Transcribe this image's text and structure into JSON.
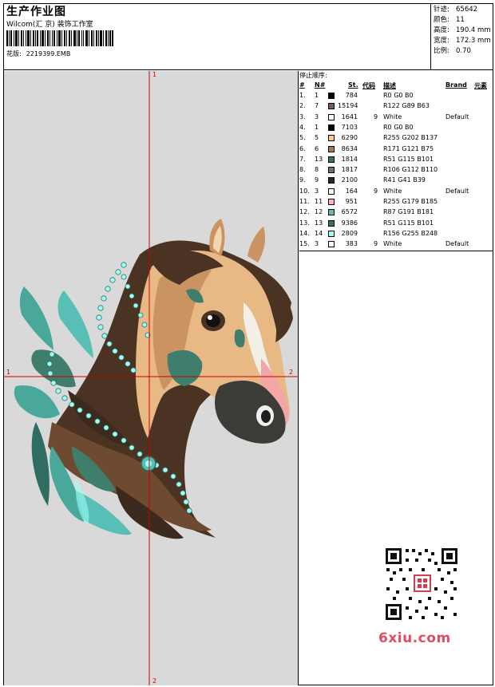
{
  "header": {
    "title": "生产作业图",
    "company": "Wilcom(汇 京) 装饰工作室",
    "pattern_label": "花版:",
    "pattern_file": "2219399.EMB"
  },
  "stats": {
    "stitches_label": "针迹:",
    "stitches": "65642",
    "colors_label": "颜色:",
    "colors": "11",
    "height_label": "高度:",
    "height": "190.4 mm",
    "width_label": "宽度:",
    "width": "172.3 mm",
    "scale_label": "比例:",
    "scale": "0.70"
  },
  "color_table": {
    "title": "停止顺序:",
    "columns": {
      "num": "#",
      "needle": "N#",
      "stitches": "St.",
      "code": "代码",
      "desc": "描述",
      "brand": "Brand",
      "element": "元素"
    },
    "rows": [
      {
        "num": "1.",
        "needle": "1",
        "color": "#000000",
        "stitches": "784",
        "code": "",
        "desc": "R0 G0 B0",
        "brand": ""
      },
      {
        "num": "2.",
        "needle": "7",
        "color": "#7a5963",
        "stitches": "15194",
        "code": "",
        "desc": "R122 G89 B63",
        "brand": ""
      },
      {
        "num": "3.",
        "needle": "3",
        "color": "#ffffff",
        "stitches": "1641",
        "code": "9",
        "desc": "White",
        "brand": "Default"
      },
      {
        "num": "4.",
        "needle": "1",
        "color": "#000000",
        "stitches": "7103",
        "code": "",
        "desc": "R0 G0 B0",
        "brand": ""
      },
      {
        "num": "5.",
        "needle": "5",
        "color": "#ffca89",
        "stitches": "6290",
        "code": "",
        "desc": "R255 G202 B137",
        "brand": ""
      },
      {
        "num": "6.",
        "needle": "6",
        "color": "#ab794b",
        "stitches": "8634",
        "code": "",
        "desc": "R171 G121 B75",
        "brand": ""
      },
      {
        "num": "7.",
        "needle": "13",
        "color": "#337365",
        "stitches": "1814",
        "code": "",
        "desc": "R51 G115 B101",
        "brand": ""
      },
      {
        "num": "8.",
        "needle": "8",
        "color": "#6a706e",
        "stitches": "1817",
        "code": "",
        "desc": "R106 G112 B110",
        "brand": ""
      },
      {
        "num": "9.",
        "needle": "9",
        "color": "#29291b",
        "stitches": "2100",
        "code": "",
        "desc": "R41 G41 B39",
        "brand": ""
      },
      {
        "num": "10.",
        "needle": "3",
        "color": "#ffffff",
        "stitches": "164",
        "code": "9",
        "desc": "White",
        "brand": "Default"
      },
      {
        "num": "11.",
        "needle": "11",
        "color": "#ffb3b9",
        "stitches": "951",
        "code": "",
        "desc": "R255 G179 B185",
        "brand": ""
      },
      {
        "num": "12.",
        "needle": "12",
        "color": "#57bfb5",
        "stitches": "6572",
        "code": "",
        "desc": "R87 G191 B181",
        "brand": ""
      },
      {
        "num": "13.",
        "needle": "13",
        "color": "#337365",
        "stitches": "9386",
        "code": "",
        "desc": "R51 G115 B101",
        "brand": ""
      },
      {
        "num": "14.",
        "needle": "14",
        "color": "#9cfff8",
        "stitches": "2809",
        "code": "",
        "desc": "R156 G255 B248",
        "brand": ""
      },
      {
        "num": "15.",
        "needle": "3",
        "color": "#ffffff",
        "stitches": "383",
        "code": "9",
        "desc": "White",
        "brand": "Default"
      }
    ]
  },
  "design": {
    "marks": {
      "top": "1",
      "bottom": "2",
      "left": "1",
      "right": "2"
    },
    "crosshair_color": "#cc0000",
    "background_color": "#d9d9d9"
  },
  "watermark": {
    "text": "6xiu.com",
    "color": "#e24b62"
  }
}
